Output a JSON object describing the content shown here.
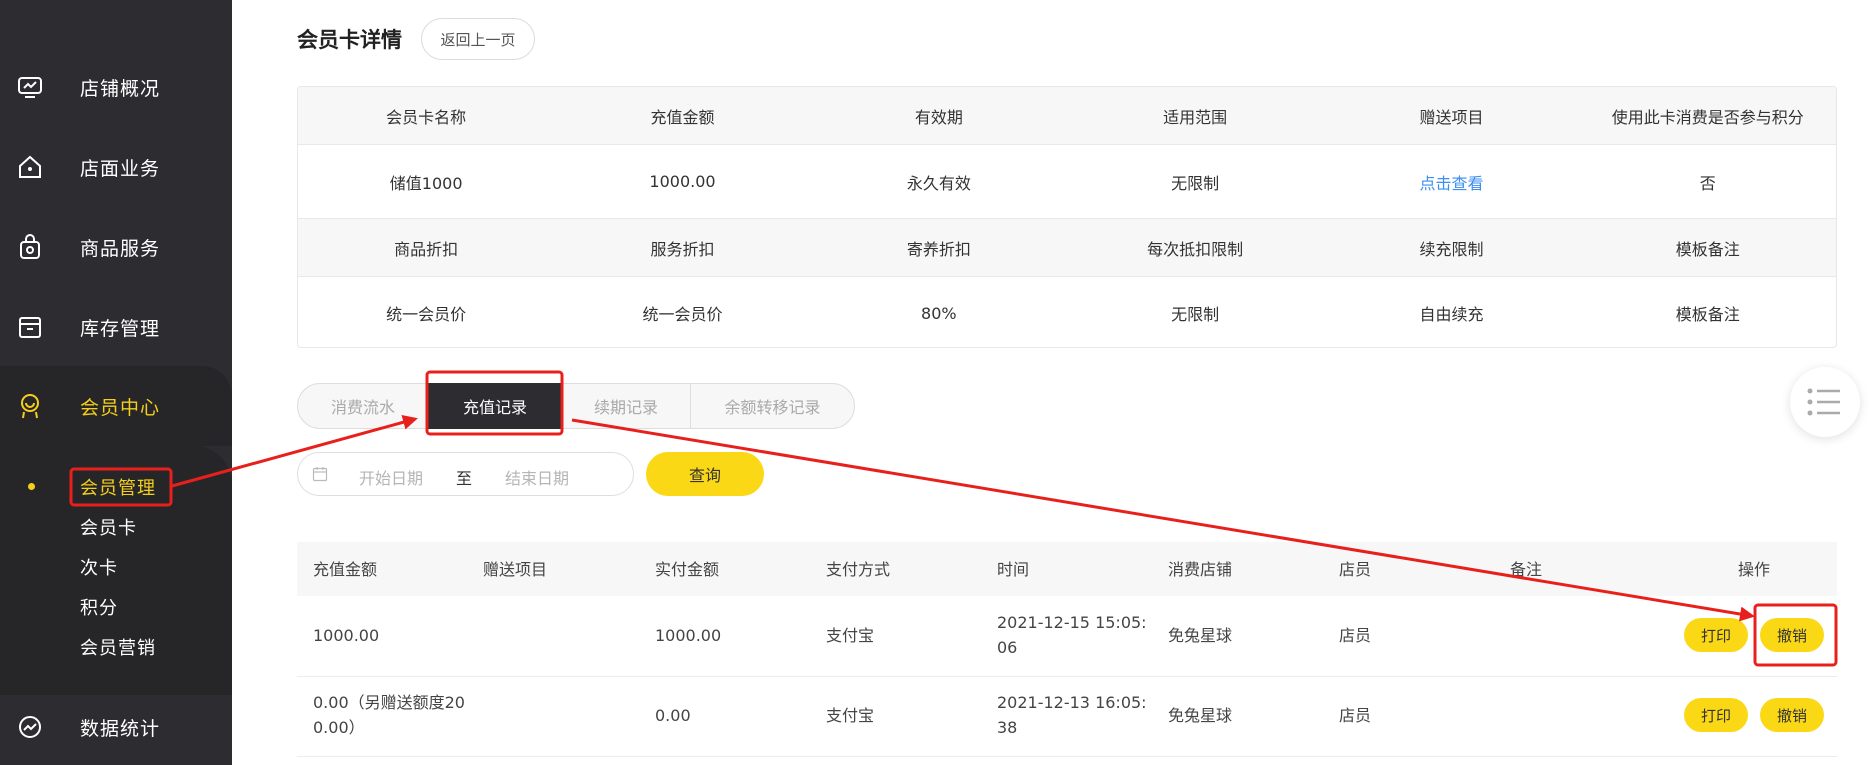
{
  "sidebar": {
    "items": [
      {
        "label": "店铺概况",
        "icon": "monitor-icon"
      },
      {
        "label": "店面业务",
        "icon": "home-icon"
      },
      {
        "label": "商品服务",
        "icon": "bag-icon"
      },
      {
        "label": "库存管理",
        "icon": "box-icon"
      },
      {
        "label": "会员中心",
        "icon": "member-icon"
      },
      {
        "label": "数据统计",
        "icon": "chart-icon"
      }
    ],
    "sub_items": [
      {
        "label": "会员管理"
      },
      {
        "label": "会员卡"
      },
      {
        "label": "次卡"
      },
      {
        "label": "积分"
      },
      {
        "label": "会员营销"
      }
    ]
  },
  "header": {
    "title": "会员卡详情",
    "back_label": "返回上一页"
  },
  "card_info": {
    "row1_headers": [
      "会员卡名称",
      "充值金额",
      "有效期",
      "适用范围",
      "赠送项目",
      "使用此卡消费是否参与积分"
    ],
    "row1_values": [
      "储值1000",
      "1000.00",
      "永久有效",
      "无限制",
      "点击查看",
      "否"
    ],
    "row2_headers": [
      "商品折扣",
      "服务折扣",
      "寄养折扣",
      "每次抵扣限制",
      "续充限制",
      "模板备注"
    ],
    "row2_values": [
      "统一会员价",
      "统一会员价",
      "80%",
      "无限制",
      "自由续充",
      "模板备注"
    ]
  },
  "tabs": [
    {
      "label": "消费流水"
    },
    {
      "label": "充值记录"
    },
    {
      "label": "续期记录"
    },
    {
      "label": "余额转移记录"
    }
  ],
  "filter": {
    "start_placeholder": "开始日期",
    "separator": "至",
    "end_placeholder": "结束日期",
    "query_label": "查询"
  },
  "records": {
    "columns": [
      "充值金额",
      "赠送项目",
      "实付金额",
      "支付方式",
      "时间",
      "消费店铺",
      "店员",
      "备注",
      "操作"
    ],
    "rows": [
      {
        "amount": "1000.00",
        "gift": "",
        "paid": "1000.00",
        "method": "支付宝",
        "time_a": "2021-12-15 15:05:",
        "time_b": "06",
        "store": "免兔星球",
        "clerk": "店员",
        "note": "",
        "print": "打印",
        "cancel": "撤销"
      },
      {
        "amount": "0.00（另赠送额度20",
        "amount_b": "0.00）",
        "gift": "",
        "paid": "0.00",
        "method": "支付宝",
        "time_a": "2021-12-13 16:05:",
        "time_b": "38",
        "store": "免兔星球",
        "clerk": "店员",
        "note": "",
        "print": "打印",
        "cancel": "撤销"
      }
    ]
  },
  "colors": {
    "accent": "#fbd816",
    "sidebar_bg": "#2d2d31",
    "active_text": "#f5cf1a",
    "highlight": "#e8201c",
    "link": "#3b8ff0"
  }
}
